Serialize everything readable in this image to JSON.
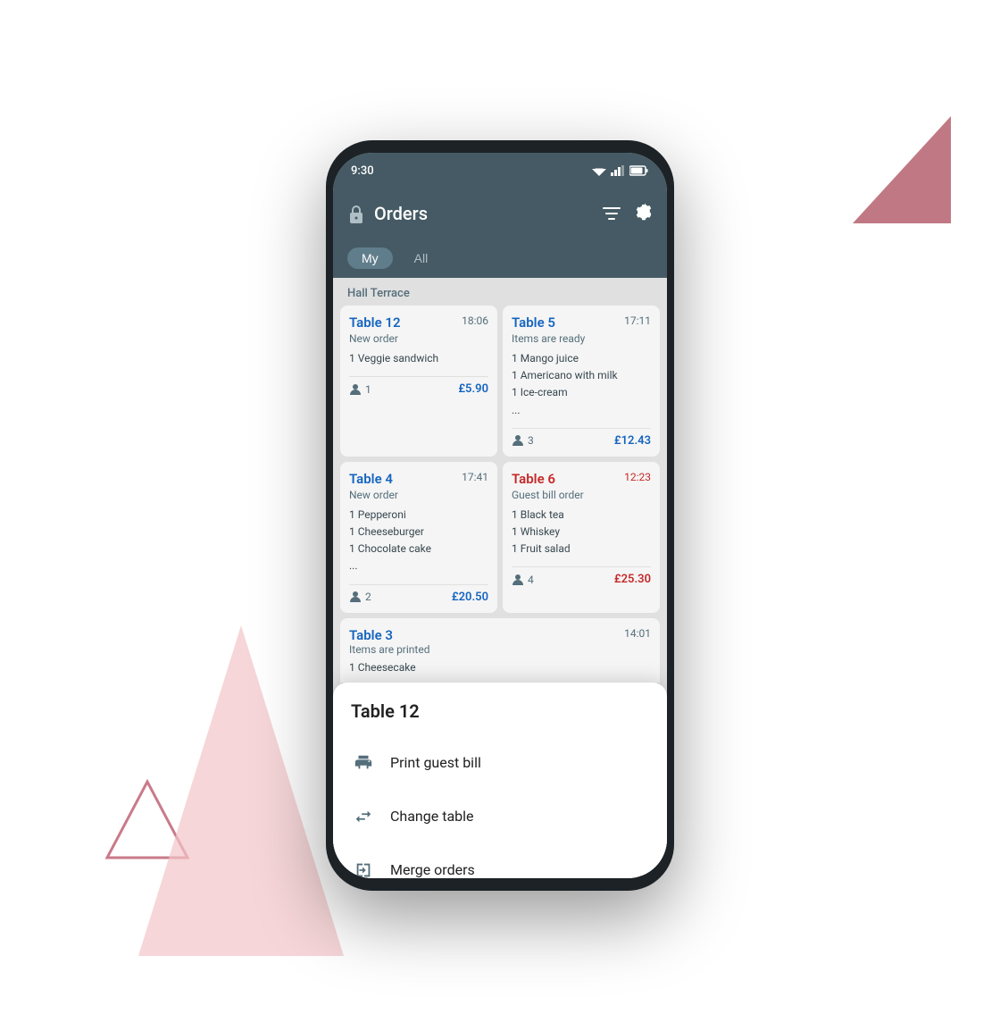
{
  "scene": {
    "status": {
      "time": "9:30"
    }
  },
  "header": {
    "title": "Orders",
    "filter_icon": "≡",
    "settings_icon": "⚙"
  },
  "tabs": {
    "my_label": "My",
    "all_label": "All",
    "active": "My"
  },
  "section": {
    "label": "Hall Terrace"
  },
  "orders": [
    {
      "table": "Table 12",
      "time": "18:06",
      "status": "New order",
      "items": [
        "1 Veggie sandwich"
      ],
      "guests": "1",
      "price": "£5.90",
      "price_color": "blue",
      "name_color": "blue"
    },
    {
      "table": "Table 5",
      "time": "17:11",
      "status": "Items are ready",
      "items": [
        "1 Mango juice",
        "1 Americano with milk",
        "1 Ice-cream",
        "..."
      ],
      "guests": "3",
      "price": "£12.43",
      "price_color": "blue",
      "name_color": "blue"
    },
    {
      "table": "Table 4",
      "time": "17:41",
      "status": "New order",
      "items": [
        "1 Pepperoni",
        "1 Cheeseburger",
        "1 Chocolate cake",
        "..."
      ],
      "guests": "2",
      "price": "£20.50",
      "price_color": "blue",
      "name_color": "blue"
    },
    {
      "table": "Table 6",
      "time": "12:23",
      "status": "Guest bill order",
      "items": [
        "1 Black tea",
        "1 Whiskey",
        "1 Fruit salad"
      ],
      "guests": "4",
      "price": "£25.30",
      "price_color": "red",
      "name_color": "red"
    }
  ],
  "table3": {
    "table": "Table 3",
    "time": "14:01",
    "status": "Items are printed",
    "items_partial": "1 Cheesecake"
  },
  "bottom_sheet": {
    "title": "Table 12",
    "items": [
      {
        "label": "Print guest bill",
        "icon": "print"
      },
      {
        "label": "Change table",
        "icon": "transfer"
      },
      {
        "label": "Merge orders",
        "icon": "merge"
      }
    ]
  }
}
